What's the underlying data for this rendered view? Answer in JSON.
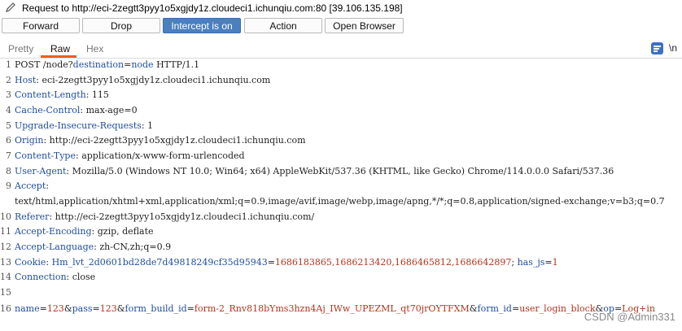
{
  "header": {
    "title": "Request to http://eci-2zegtt3pyy1o5xgjdy1z.cloudeci1.ichunqiu.com:80  [39.106.135.198]"
  },
  "buttons": {
    "forward": "Forward",
    "drop": "Drop",
    "intercept": "Intercept is on",
    "action": "Action",
    "open_browser": "Open Browser"
  },
  "tabs": {
    "pretty": "Pretty",
    "raw": "Raw",
    "hex": "Hex"
  },
  "toolbar": {
    "newline_toggle": "\\n"
  },
  "lines": {
    "l1": {
      "num": "1",
      "method": "POST /node?",
      "p1k": "destination",
      "eq": "=",
      "p1v": "node",
      "proto": " HTTP/1.1"
    },
    "l2": {
      "num": "2",
      "key": "Host",
      "val": ": eci-2zegtt3pyy1o5xgjdy1z.cloudeci1.ichunqiu.com"
    },
    "l3": {
      "num": "3",
      "key": "Content-Length",
      "val": ": 115"
    },
    "l4": {
      "num": "4",
      "key": "Cache-Control",
      "val": ": max-age=0"
    },
    "l5": {
      "num": "5",
      "key": "Upgrade-Insecure-Requests",
      "val": ": 1"
    },
    "l6": {
      "num": "6",
      "key": "Origin",
      "val": ": http://eci-2zegtt3pyy1o5xgjdy1z.cloudeci1.ichunqiu.com"
    },
    "l7": {
      "num": "7",
      "key": "Content-Type",
      "val": ": application/x-www-form-urlencoded"
    },
    "l8": {
      "num": "8",
      "key": "User-Agent",
      "val": ": Mozilla/5.0 (Windows NT 10.0; Win64; x64) AppleWebKit/537.36 (KHTML, like Gecko) Chrome/114.0.0.0 Safari/537.36"
    },
    "l9": {
      "num": "9",
      "key": "Accept",
      "val": ":",
      "cont": "text/html,application/xhtml+xml,application/xml;q=0.9,image/avif,image/webp,image/apng,*/*;q=0.8,application/signed-exchange;v=b3;q=0.7"
    },
    "l10": {
      "num": "10",
      "key": "Referer",
      "val": ": http://eci-2zegtt3pyy1o5xgjdy1z.cloudeci1.ichunqiu.com/"
    },
    "l11": {
      "num": "11",
      "key": "Accept-Encoding",
      "val": ": gzip, deflate"
    },
    "l12": {
      "num": "12",
      "key": "Accept-Language",
      "val": ": zh-CN,zh;q=0.9"
    },
    "l13": {
      "num": "13",
      "key": "Cookie",
      "sep": ": ",
      "c1k": "Hm_lvt_2d0601bd28de7d49818249cf35d95943",
      "c1eq": "=",
      "c1v": "1686183865,1686213420,1686465812,1686642897",
      "semi": "; ",
      "c2k": "has_js",
      "c2eq": "=",
      "c2v": "1"
    },
    "l14": {
      "num": "14",
      "key": "Connection",
      "val": ": close"
    },
    "l15": {
      "num": "15"
    },
    "l16": {
      "num": "16",
      "a_k": "name",
      "a_v": "123",
      "b_k": "pass",
      "b_v": "123",
      "c_k": "form_build_id",
      "c_v": "form-2_Rnv818bYms3hzn4Aj_IWw_UPEZML_qt70jrOYTFXM",
      "d_k": "form_id",
      "d_v": "user_login_block",
      "e_k": "op",
      "e_v": "Log+in",
      "eq": "=",
      "amp": "&"
    }
  },
  "watermark": "CSDN @Admin331",
  "colors": {
    "header_key": "#1f4c9c",
    "param_value": "#b0341c",
    "intercept_on": "#4a7fc0",
    "tab_accent": "#e8611a"
  }
}
